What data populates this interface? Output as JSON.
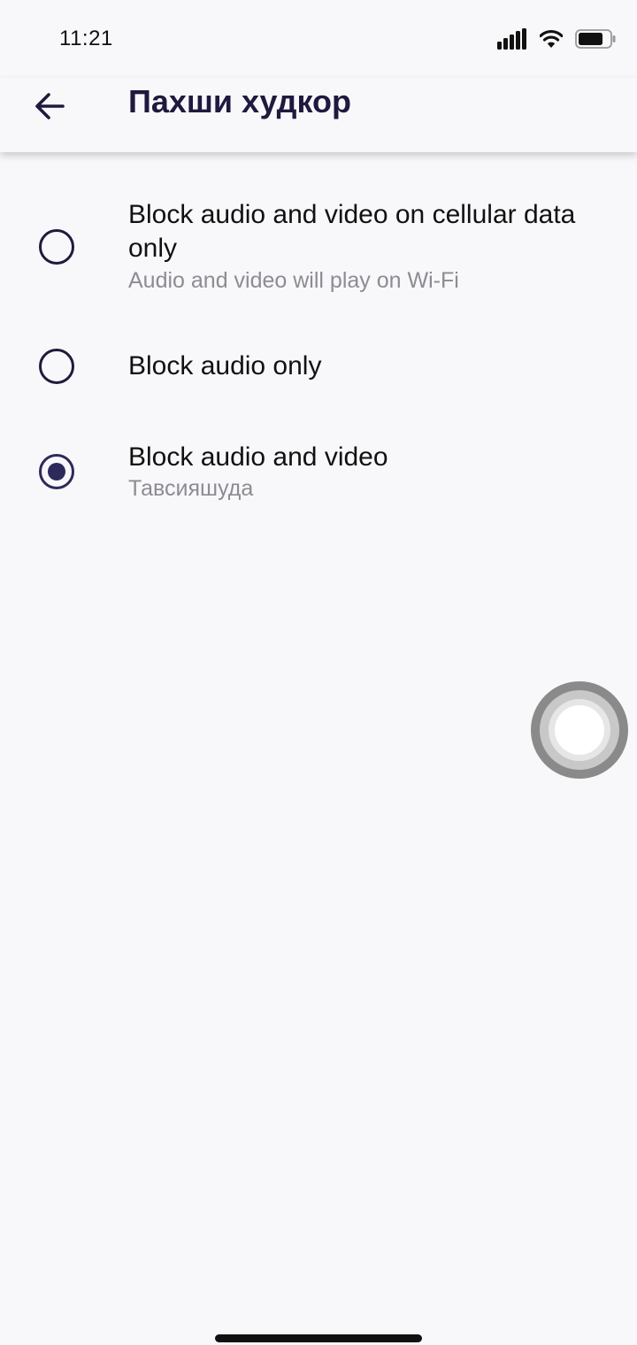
{
  "status_bar": {
    "time": "11:21"
  },
  "header": {
    "title": "Пахши худкор"
  },
  "options": [
    {
      "label": "Block audio and video on cellular data only",
      "subtitle": "Audio and video will play on Wi-Fi",
      "selected": false
    },
    {
      "label": "Block audio only",
      "subtitle": "",
      "selected": false
    },
    {
      "label": "Block audio and video",
      "subtitle": "Тавсияшуда",
      "selected": true
    }
  ],
  "colors": {
    "background": "#f8f8fb",
    "accent": "#2d2a5a",
    "title": "#1f1a3d",
    "subtitle": "#8c8c92"
  },
  "icons": {
    "back": "arrow-left-icon",
    "signal": "cellular-signal-icon",
    "wifi": "wifi-icon",
    "battery": "battery-icon",
    "assistive": "assistive-touch-icon"
  }
}
